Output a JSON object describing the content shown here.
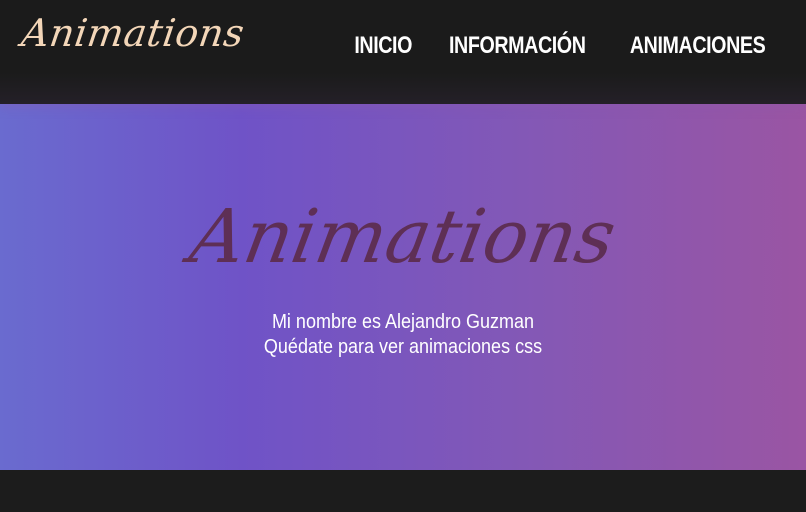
{
  "header": {
    "logo_text": "Animations",
    "nav": {
      "inicio": "INICIO",
      "informacion": "INFORMACIÓN",
      "animaciones": "ANIMACIONES"
    }
  },
  "hero": {
    "title": "Animations",
    "line1": "Mi nombre es Alejandro Guzman",
    "line2": "Quédate para ver animaciones css"
  },
  "colors": {
    "header_bg": "#1b1b1b",
    "logo": "#f3d6b8",
    "hero_gradient_start": "#6a6bcf",
    "hero_gradient_end": "#9a55a3",
    "hero_title": "#5e2f55",
    "text": "#ffffff"
  }
}
